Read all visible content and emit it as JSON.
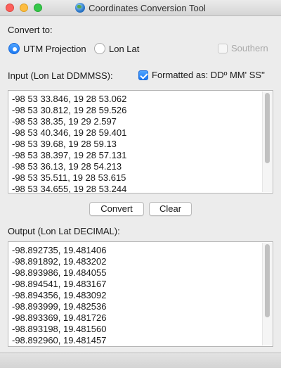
{
  "window": {
    "title": "Coordinates Conversion Tool"
  },
  "convert_to": {
    "label": "Convert to:",
    "options": [
      {
        "label": "UTM Projection",
        "selected": true
      },
      {
        "label": "Lon Lat",
        "selected": false
      }
    ],
    "southern": {
      "label": "Southern",
      "checked": false,
      "enabled": false
    }
  },
  "input": {
    "label": "Input (Lon Lat DDMMSS):",
    "formatted": {
      "label": "Formatted as: DDº MM' SS''",
      "checked": true
    },
    "lines": [
      "-98 53 33.846, 19 28 53.062",
      "-98 53 30.812, 19 28 59.526",
      "-98 53 38.35, 19 29 2.597",
      "-98 53 40.346, 19 28 59.401",
      "-98 53 39.68, 19 28 59.13",
      "-98 53 38.397, 19 28 57.131",
      "-98 53 36.13, 19 28 54.213",
      "-98 53 35.511, 19 28 53.615",
      "-98 53 34.655, 19 28 53.244"
    ]
  },
  "actions": {
    "convert": "Convert",
    "clear": "Clear"
  },
  "output": {
    "label": "Output (Lon Lat DECIMAL):",
    "lines": [
      "-98.892735, 19.481406",
      "-98.891892, 19.483202",
      "-98.893986, 19.484055",
      "-98.894541, 19.483167",
      "-98.894356, 19.483092",
      "-98.893999, 19.482536",
      "-98.893369, 19.481726",
      "-98.893198, 19.481560",
      "-98.892960, 19.481457"
    ]
  }
}
